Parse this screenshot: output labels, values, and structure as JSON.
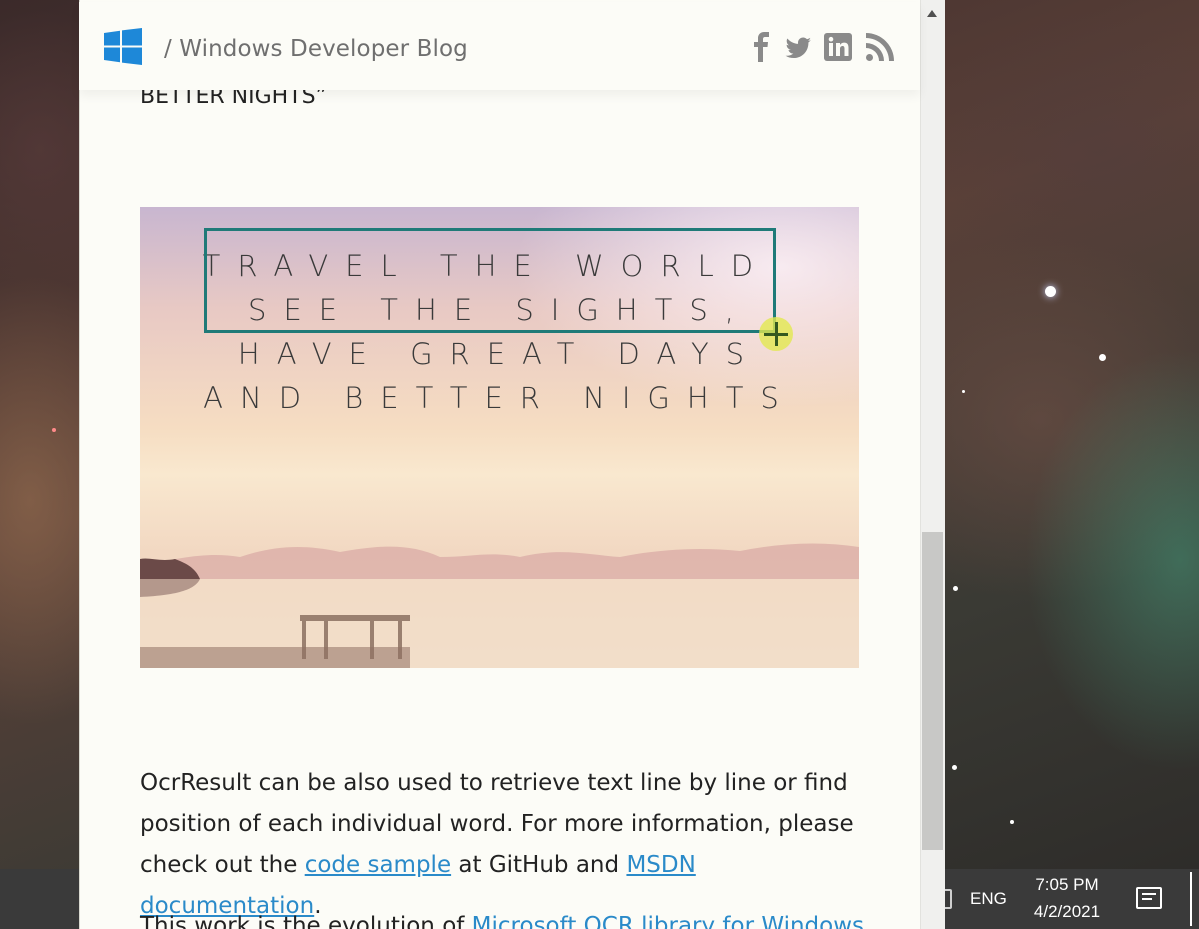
{
  "header": {
    "blog_title": "/ Windows Developer Blog",
    "social_icons": [
      "facebook-icon",
      "twitter-icon",
      "linkedin-icon",
      "rss-icon"
    ]
  },
  "article": {
    "previous_text_fragment": "BETTER NIGHTS”",
    "image_text_lines": [
      "TRAVEL THE WORLD,",
      "SEE THE SIGHTS,",
      "HAVE GREAT DAYS",
      "AND BETTER NIGHTS"
    ],
    "paragraph": {
      "line1": "OcrResult can be also used to retrieve text line by line or find",
      "line2": "position of each individual word. For more information, please",
      "line3_before": "check out the ",
      "link_code_sample": "code sample",
      "line3_middle": " at GitHub and ",
      "link_msdn": "MSDN documentation",
      "line3_after": "."
    },
    "cut_off_line": {
      "before": "This work is the evolution of ",
      "link": "Microsoft OCR library for Windows"
    }
  },
  "taskbar": {
    "language": "ENG",
    "time": "7:05 PM",
    "date": "4/2/2021"
  },
  "colors": {
    "link": "#2a8ac9",
    "selection_box": "#1f7a78",
    "windows_logo": "#1e88d8",
    "social_icon": "#8a8a8a"
  }
}
